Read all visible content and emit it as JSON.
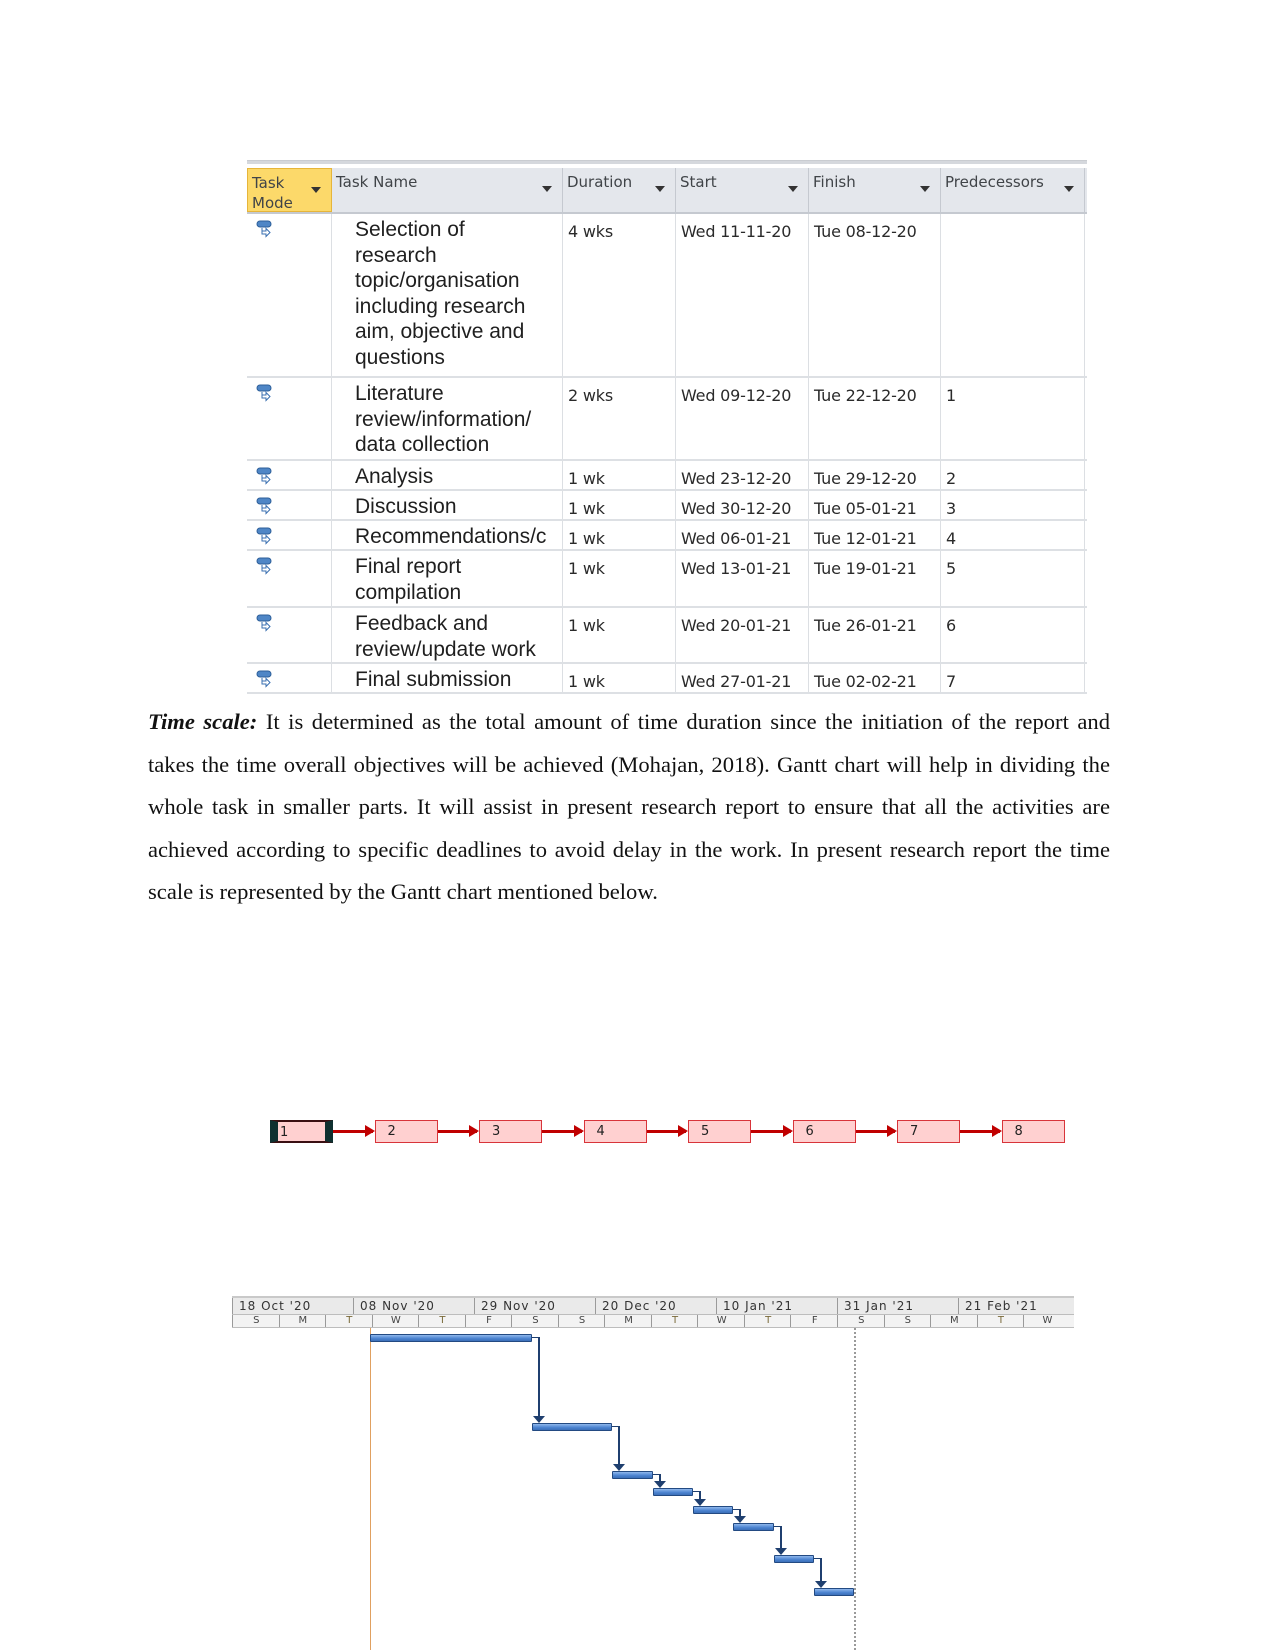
{
  "task_table": {
    "columns": [
      {
        "label": "Task\nMode",
        "key": "mode"
      },
      {
        "label": "Task Name",
        "key": "name"
      },
      {
        "label": "Duration",
        "key": "duration"
      },
      {
        "label": "Start",
        "key": "start"
      },
      {
        "label": "Finish",
        "key": "finish"
      },
      {
        "label": "Predecessors",
        "key": "predecessors"
      }
    ],
    "rows": [
      {
        "id": 1,
        "mode_icon": "auto-scheduled-task-icon",
        "name": "Selection of research topic/organisation including research aim, objective and questions",
        "name_lines": [
          "Selection of",
          "research",
          "topic/organisation",
          "including research",
          "aim, objective and",
          "questions"
        ],
        "duration": "4 wks",
        "start": "Wed 11-11-20",
        "finish": "Tue 08-12-20",
        "predecessors": ""
      },
      {
        "id": 2,
        "mode_icon": "auto-scheduled-task-icon",
        "name": "Literature review/information/ data collection",
        "name_lines": [
          "Literature",
          "review/information/",
          "data collection"
        ],
        "duration": "2 wks",
        "start": "Wed 09-12-20",
        "finish": "Tue 22-12-20",
        "predecessors": "1"
      },
      {
        "id": 3,
        "mode_icon": "auto-scheduled-task-icon",
        "name": "Analysis",
        "name_lines": [
          "Analysis"
        ],
        "duration": "1 wk",
        "start": "Wed 23-12-20",
        "finish": "Tue 29-12-20",
        "predecessors": "2"
      },
      {
        "id": 4,
        "mode_icon": "auto-scheduled-task-icon",
        "name": "Discussion",
        "name_lines": [
          "Discussion"
        ],
        "duration": "1 wk",
        "start": "Wed 30-12-20",
        "finish": "Tue 05-01-21",
        "predecessors": "3"
      },
      {
        "id": 5,
        "mode_icon": "auto-scheduled-task-icon",
        "name": "Recommendations/c",
        "name_lines": [
          "Recommendations/c"
        ],
        "duration": "1 wk",
        "start": "Wed 06-01-21",
        "finish": "Tue 12-01-21",
        "predecessors": "4"
      },
      {
        "id": 6,
        "mode_icon": "auto-scheduled-task-icon",
        "name": "Final report compilation",
        "name_lines": [
          "Final report",
          "compilation"
        ],
        "duration": "1 wk",
        "start": "Wed 13-01-21",
        "finish": "Tue 19-01-21",
        "predecessors": "5"
      },
      {
        "id": 7,
        "mode_icon": "auto-scheduled-task-icon",
        "name": "Feedback and review/update work",
        "name_lines": [
          "Feedback and",
          "review/update work"
        ],
        "duration": "1 wk",
        "start": "Wed 20-01-21",
        "finish": "Tue 26-01-21",
        "predecessors": "6"
      },
      {
        "id": 8,
        "mode_icon": "auto-scheduled-task-icon",
        "name": "Final submission",
        "name_lines": [
          "Final submission"
        ],
        "duration": "1 wk",
        "start": "Wed 27-01-21",
        "finish": "Tue 02-02-21",
        "predecessors": "7"
      }
    ],
    "header_highlight_color": "#fcd96a"
  },
  "paragraph": {
    "lead": "Time scale:",
    "text": " It is determined as the total amount of time duration since the initiation of the report and takes the time overall objectives will be achieved (Mohajan, 2018). Gantt chart will help in dividing the whole task in smaller parts. It will assist in present research report to ensure that all the activities are achieved according to specific deadlines to avoid delay in the work. In present research report the time scale is represented by the Gantt chart mentioned below."
  },
  "network_diagram": {
    "nodes": [
      "1",
      "2",
      "3",
      "4",
      "5",
      "6",
      "7",
      "8"
    ],
    "links": [
      [
        "1",
        "2"
      ],
      [
        "2",
        "3"
      ],
      [
        "3",
        "4"
      ],
      [
        "4",
        "5"
      ],
      [
        "5",
        "6"
      ],
      [
        "6",
        "7"
      ],
      [
        "7",
        "8"
      ]
    ],
    "node_fill": "#ffd0d0",
    "link_color": "#c00000"
  },
  "gantt": {
    "timescale_major": [
      "18 Oct '20",
      "08 Nov '20",
      "29 Nov '20",
      "20 Dec '20",
      "10 Jan '21",
      "31 Jan '21",
      "21 Feb '21"
    ],
    "timescale_minor": [
      "S",
      "M",
      "T",
      "W",
      "T",
      "F",
      "S",
      "S",
      "M",
      "T",
      "W",
      "T",
      "F",
      "S",
      "S",
      "M",
      "T",
      "W"
    ],
    "axis_start": "2020-10-18",
    "bars": [
      {
        "task": 1,
        "start": "2020-11-11",
        "finish": "2020-12-08"
      },
      {
        "task": 2,
        "start": "2020-12-09",
        "finish": "2020-12-22"
      },
      {
        "task": 3,
        "start": "2020-12-23",
        "finish": "2020-12-29"
      },
      {
        "task": 4,
        "start": "2020-12-30",
        "finish": "2021-01-05"
      },
      {
        "task": 5,
        "start": "2021-01-06",
        "finish": "2021-01-12"
      },
      {
        "task": 6,
        "start": "2021-01-13",
        "finish": "2021-01-19"
      },
      {
        "task": 7,
        "start": "2021-01-20",
        "finish": "2021-01-26"
      },
      {
        "task": 8,
        "start": "2021-01-27",
        "finish": "2021-02-02"
      }
    ],
    "project_start_line": "2020-11-11",
    "status_date_line": "2021-02-02",
    "bar_color": "#4a82cf"
  }
}
